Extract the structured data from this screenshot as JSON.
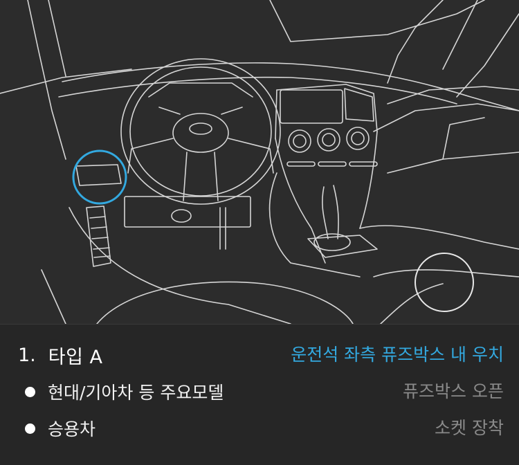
{
  "theme": {
    "accent_color": "#33a9e0",
    "line_color": "#d9d9d9",
    "background": "#2b2b2b"
  },
  "illustration": {
    "highlight_icon": "circle-highlight-icon",
    "secondary_icon": "circle-outline-icon"
  },
  "section": {
    "number": "1.",
    "title": "타입 A",
    "location": "운전석 좌측 퓨즈박스 내 우치"
  },
  "items": [
    {
      "label": "현대/기아차 등 주요모델",
      "action": "퓨즈박스 오픈"
    },
    {
      "label": "승용차",
      "action": "소켓 장착"
    }
  ]
}
